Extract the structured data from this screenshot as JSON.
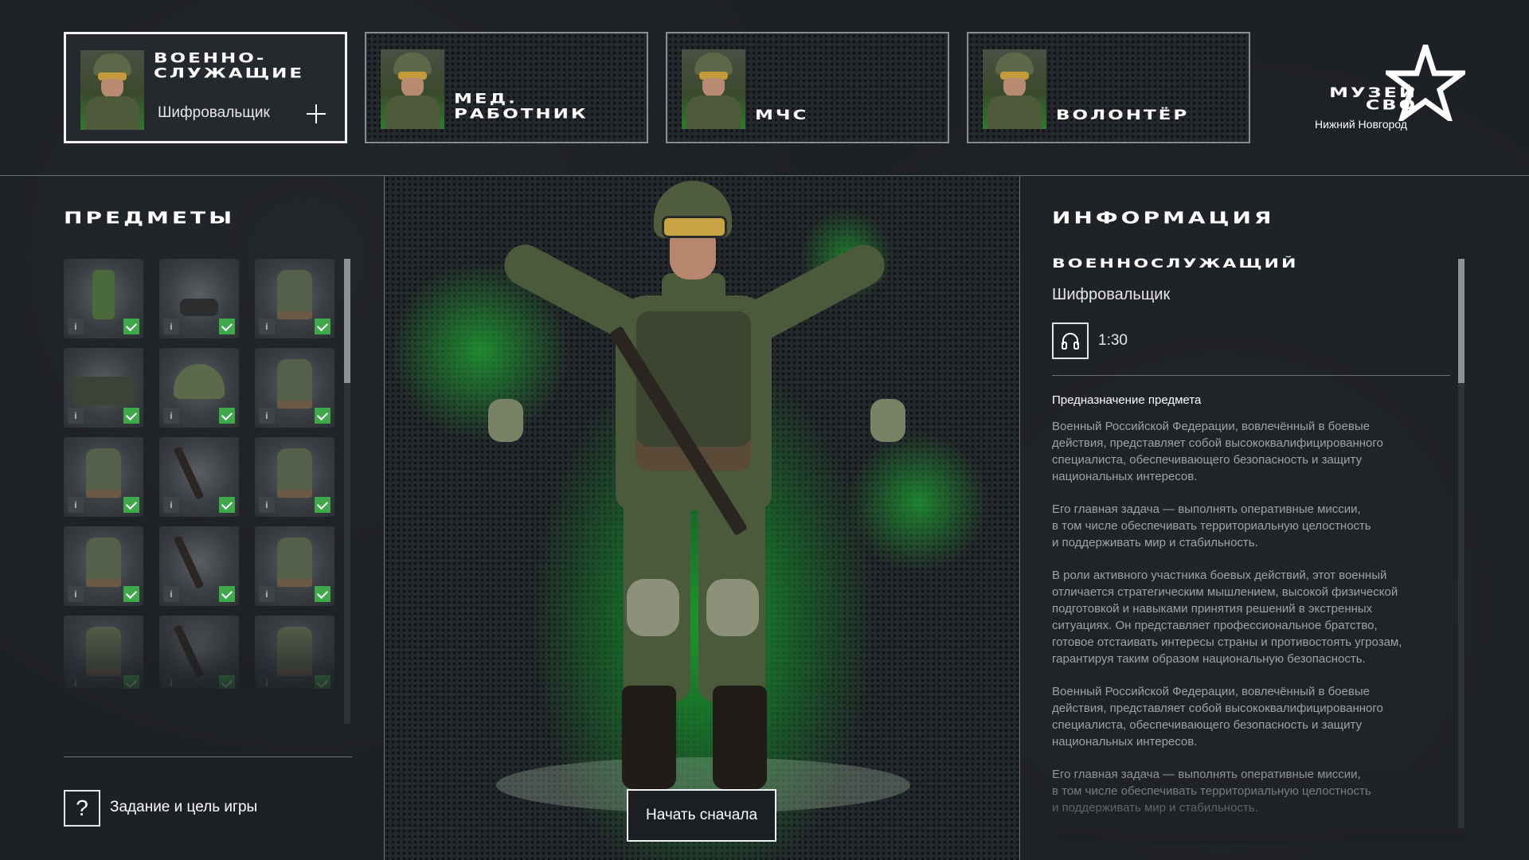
{
  "categories": [
    {
      "title": "ВОЕННО-\nСЛУЖАЩИЕ",
      "subtitle": "Шифровальщик",
      "active": true
    },
    {
      "title": "МЕД.\nРАБОТНИК",
      "active": false
    },
    {
      "title": "МЧС",
      "active": false
    },
    {
      "title": "ВОЛОНТЁР",
      "active": false
    }
  ],
  "logo": {
    "title": "МУЗЕЙ\nСВО",
    "city": "Нижний Новгород"
  },
  "left_panel": {
    "title": "ПРЕДМЕТЫ",
    "help_label": "Задание и цель игры",
    "help_icon_text": "?",
    "info_icon_text": "i",
    "items": [
      {
        "icon": "uniform-icon",
        "checked": true
      },
      {
        "icon": "gloves-icon",
        "checked": true
      },
      {
        "icon": "vest-icon",
        "checked": true
      },
      {
        "icon": "gear-kit-icon",
        "checked": true
      },
      {
        "icon": "helmet-icon",
        "checked": true
      },
      {
        "icon": "vest-icon",
        "checked": true
      },
      {
        "icon": "vest-icon",
        "checked": true
      },
      {
        "icon": "rifle-icon",
        "checked": true
      },
      {
        "icon": "vest-icon",
        "checked": true
      },
      {
        "icon": "vest-icon",
        "checked": true
      },
      {
        "icon": "rifle-icon",
        "checked": true
      },
      {
        "icon": "vest-icon",
        "checked": true
      },
      {
        "icon": "vest-icon",
        "checked": true
      },
      {
        "icon": "rifle-icon",
        "checked": true
      },
      {
        "icon": "vest-icon",
        "checked": true
      }
    ]
  },
  "viewer": {
    "restart_label": "Начать сначала"
  },
  "info": {
    "title": "ИНФОРМАЦИЯ",
    "subheading": "ВОЕННОСЛУЖАЩИЙ",
    "role": "Шифровальщик",
    "audio_icon": "headphones-icon",
    "audio_duration": "1:30",
    "purpose_label": "Предназначение предмета",
    "paragraphs": [
      "Военный Российской Федерации, вовлечённый в боевые\nдействия, представляет собой высококвалифицированного\nспециалиста, обеспечивающего безопасность и защиту\nнациональных интересов.",
      "Его главная задача — выполнять оперативные миссии,\nв том числе обеспечивать территориальную целостность\nи поддерживать мир и стабильность.",
      "В роли активного участника боевых действий, этот военный\nотличается стратегическим мышлением, высокой физической\nподготовкой и навыками принятия решений в экстренных\nситуациях. Он представляет профессиональное братство,\nготовое отстаивать интересы страны и противостоять угрозам,\nгарантируя таким образом национальную безопасность.",
      "Военный Российской Федерации, вовлечённый в боевые\nдействия, представляет собой высококвалифицированного\nспециалиста, обеспечивающего безопасность и защиту\nнациональных интересов.",
      "Его главная задача — выполнять оперативные миссии,\nв том числе обеспечивать территориальную целостность\nи поддерживать мир и стабильность."
    ]
  },
  "colors": {
    "accent_green": "#3ea94a",
    "background": "#1d2025",
    "border": "#6c7075"
  }
}
